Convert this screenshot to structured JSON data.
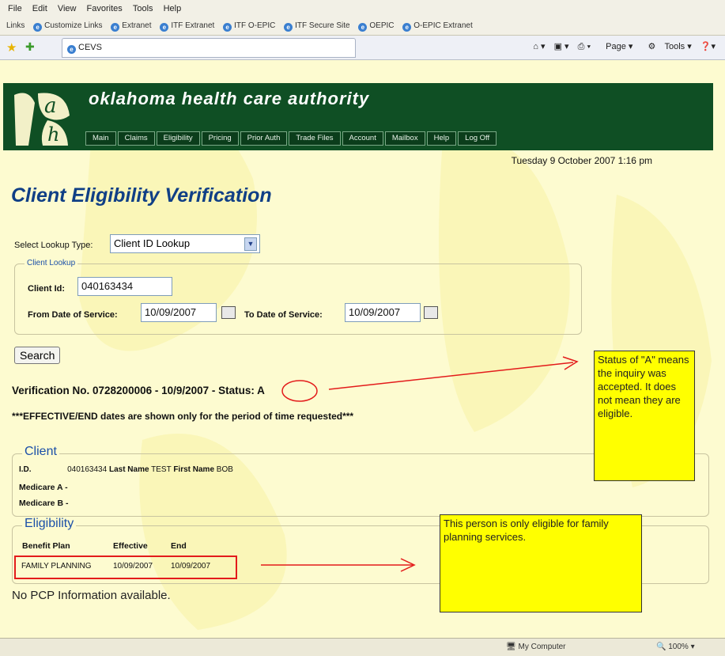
{
  "menu": [
    "File",
    "Edit",
    "View",
    "Favorites",
    "Tools",
    "Help"
  ],
  "links": {
    "label": "Links",
    "items": [
      "Customize Links",
      "Extranet",
      "ITF Extranet",
      "ITF O-EPIC",
      "ITF Secure Site",
      "OEPIC",
      "O-EPIC Extranet"
    ]
  },
  "browser": {
    "tab_title": "CEVS",
    "tools": [
      "Page",
      "Tools"
    ]
  },
  "header": {
    "org_name": "oklahoma health care authority",
    "nav": [
      "Main",
      "Claims",
      "Eligibility",
      "Pricing",
      "Prior Auth",
      "Trade Files",
      "Account",
      "Mailbox",
      "Help",
      "Log Off"
    ],
    "datetime": "Tuesday 9 October 2007 1:16 pm"
  },
  "page_title": "Client Eligibility Verification",
  "lookup": {
    "type_label": "Select Lookup Type:",
    "type_value": "Client ID Lookup",
    "legend": "Client Lookup",
    "client_id_label": "Client Id:",
    "client_id_value": "040163434",
    "from_label": "From Date of Service:",
    "from_value": "10/09/2007",
    "to_label": "To Date of Service:",
    "to_value": "10/09/2007"
  },
  "search_label": "Search",
  "verification": {
    "text": "Verification No. 0728200006 - 10/9/2007 - Status:",
    "status": "A"
  },
  "notice": "***EFFECTIVE/END dates are shown only for the period of time requested***",
  "client": {
    "legend": "Client",
    "id_label": "I.D.",
    "id_value": "040163434",
    "last_name_label": "Last Name",
    "last_name_value": "TEST",
    "first_name_label": "First Name",
    "first_name_value": "BOB",
    "medicare_a": "Medicare A -",
    "medicare_b": "Medicare B -"
  },
  "eligibility": {
    "legend": "Eligibility",
    "headers": [
      "Benefit Plan",
      "Effective",
      "End"
    ],
    "row": [
      "FAMILY PLANNING",
      "10/09/2007",
      "10/09/2007"
    ]
  },
  "pcp_text": "No PCP Information available.",
  "annotations": {
    "status_note": "Status of \"A\" means the inquiry was accepted. It does not mean they are eligible.",
    "plan_note": "This person is only eligible for family planning services.",
    "color": "#ffff00",
    "arrow_color": "#e31b1b"
  },
  "status_bar": {
    "zone": "My Computer",
    "zoom": "100%"
  }
}
